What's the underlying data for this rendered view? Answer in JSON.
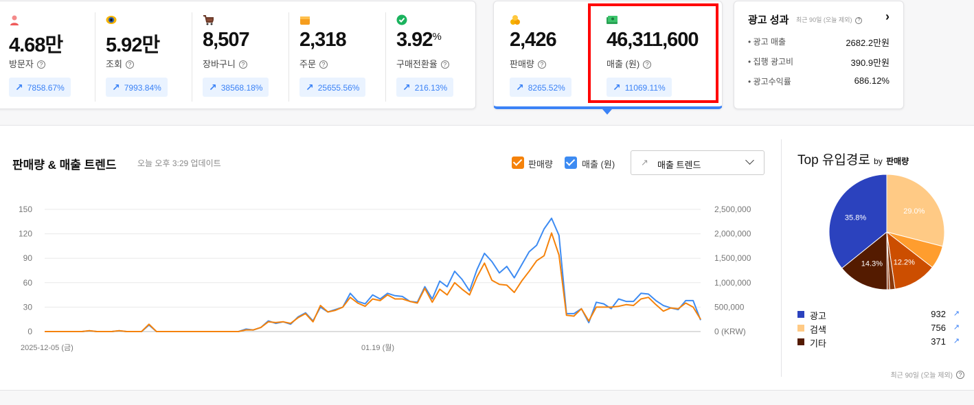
{
  "stats": [
    {
      "icon": "person-icon",
      "value": "4.68만",
      "label": "방문자",
      "change": "7858.67%"
    },
    {
      "icon": "eye-icon",
      "value": "5.92만",
      "label": "조회",
      "change": "7993.84%"
    },
    {
      "icon": "cart-icon",
      "value": "8,507",
      "label": "장바구니",
      "change": "38568.18%"
    },
    {
      "icon": "box-icon",
      "value": "2,318",
      "label": "주문",
      "change": "25655.56%"
    },
    {
      "icon": "check-icon",
      "value": "3.92",
      "unit": "%",
      "label": "구매전환율",
      "change": "216.13%"
    }
  ],
  "sales_card": [
    {
      "icon": "coins-icon",
      "value": "2,426",
      "label": "판매량",
      "change": "8265.52%"
    },
    {
      "icon": "money-icon",
      "value": "46,311,600",
      "label": "매출 (원)",
      "change": "11069.11%"
    }
  ],
  "ads": {
    "title": "광고 성과",
    "subtitle": "최근 90일 (오늘 제외)",
    "rows": [
      {
        "label": "광고 매출",
        "value": "2682.2만원"
      },
      {
        "label": "집행 광고비",
        "value": "390.9만원"
      },
      {
        "label": "광고수익률",
        "value": "686.12%"
      }
    ]
  },
  "trend": {
    "title": "판매량 & 매출 트렌드",
    "updated": "오늘 오후 3:29 업데이트",
    "legend_sales": "판매량",
    "legend_revenue": "매출 (원)",
    "dropdown": "매출 트렌드"
  },
  "colors": {
    "sales": "#F5820A",
    "revenue": "#3D8BF2",
    "accent": "#3b82f6",
    "highlight": "#ff0000"
  },
  "chart_data": {
    "type": "line",
    "x_start": "2025-12-05 (금)",
    "x_mid": "01.19 (월)",
    "left_axis": {
      "ticks": [
        "0",
        "30",
        "60",
        "90",
        "120",
        "150"
      ],
      "range": [
        0,
        150
      ]
    },
    "right_axis": {
      "ticks": [
        "0 (KRW)",
        "500,000",
        "1,000,000",
        "1,500,000",
        "2,000,000",
        "2,500,000"
      ],
      "range": [
        0,
        2500000
      ]
    },
    "series": [
      {
        "name": "판매량",
        "values": [
          0,
          0,
          0,
          0,
          0,
          0,
          1,
          0,
          0,
          0,
          1,
          0,
          0,
          0,
          9,
          0,
          0,
          0,
          0,
          0,
          0,
          0,
          0,
          0,
          0,
          0,
          0,
          2,
          2,
          5,
          12,
          11,
          12,
          10,
          17,
          22,
          12,
          32,
          24,
          26,
          30,
          42,
          35,
          31,
          40,
          38,
          45,
          40,
          40,
          37,
          35,
          53,
          36,
          52,
          45,
          60,
          52,
          45,
          67,
          84,
          63,
          58,
          57,
          48,
          62,
          74,
          87,
          93,
          121,
          94,
          20,
          19,
          28,
          13,
          30,
          30,
          30,
          31,
          33,
          32,
          40,
          42,
          33,
          25,
          29,
          28,
          35,
          30,
          15
        ]
      },
      {
        "name": "매출 (원)",
        "values": [
          0,
          0,
          0,
          0,
          0,
          0,
          15000,
          0,
          0,
          0,
          15000,
          0,
          0,
          0,
          133000,
          0,
          0,
          0,
          0,
          0,
          0,
          0,
          0,
          0,
          0,
          0,
          0,
          50000,
          33000,
          83000,
          217000,
          167000,
          200000,
          150000,
          300000,
          383000,
          217000,
          500000,
          400000,
          450000,
          500000,
          783000,
          617000,
          567000,
          750000,
          667000,
          783000,
          733000,
          717000,
          617000,
          600000,
          917000,
          667000,
          1033000,
          917000,
          1233000,
          1067000,
          833000,
          1267000,
          1600000,
          1433000,
          1200000,
          1333000,
          1100000,
          1367000,
          1633000,
          1767000,
          2100000,
          2317000,
          1967000,
          367000,
          367000,
          467000,
          183000,
          600000,
          567000,
          467000,
          667000,
          617000,
          617000,
          783000,
          767000,
          633000,
          533000,
          483000,
          450000,
          633000,
          633000,
          233000
        ]
      }
    ]
  },
  "top_source": {
    "title": "Top 유입경로",
    "by": "by",
    "metric": "판매량",
    "footer": "최근 90일 (오늘 제외)",
    "slices": [
      {
        "value": 29.0,
        "label": "29.0%",
        "color": "#FFCA85"
      },
      {
        "value": 6.5,
        "label": "",
        "color": "#FF9D2E"
      },
      {
        "value": 12.2,
        "label": "12.2%",
        "color": "#CC4E00"
      },
      {
        "value": 1.5,
        "label": "",
        "color": "#8B3A0C"
      },
      {
        "value": 0.7,
        "label": "",
        "color": "#A0522D"
      },
      {
        "value": 14.3,
        "label": "14.3%",
        "color": "#541B00"
      },
      {
        "value": 35.8,
        "label": "35.8%",
        "color": "#2B42BE"
      }
    ],
    "legend": [
      {
        "label": "광고",
        "value": "932",
        "color": "#2B42BE"
      },
      {
        "label": "검색",
        "value": "756",
        "color": "#FFCA85"
      },
      {
        "label": "기타",
        "value": "371",
        "color": "#541B00"
      }
    ]
  }
}
